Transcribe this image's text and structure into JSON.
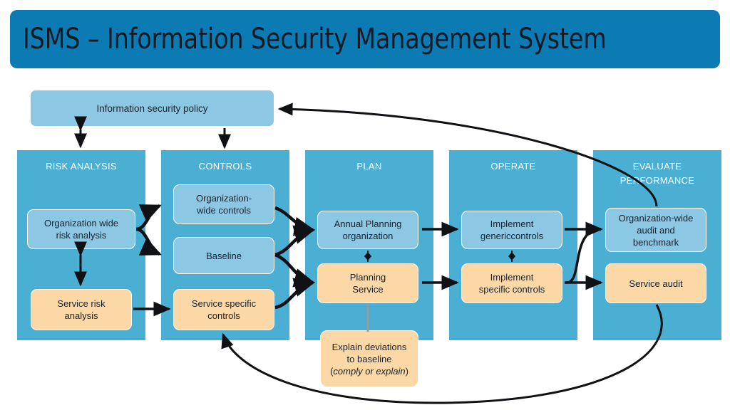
{
  "title": {
    "text": "ISMS – Information Security Management System"
  },
  "policy": {
    "label": "Information security policy"
  },
  "colors": {
    "title_bar": "#0C7BB3",
    "panel": "#4BAFD4",
    "node_blue": "#8CC8E4",
    "node_orange": "#FBD8A5",
    "connector": "#0f1115",
    "text": "#17212E"
  },
  "columns": [
    {
      "key": "risk_analysis",
      "title": "RISK ANALYSIS",
      "nodes": [
        {
          "key": "org_risk",
          "label": "Organization wide risk analysis",
          "color": "blue"
        },
        {
          "key": "service_risk",
          "label": "Service risk analysis",
          "color": "orange"
        }
      ]
    },
    {
      "key": "controls",
      "title": "CONTROLS",
      "nodes": [
        {
          "key": "org_controls",
          "label": "Organization-wide controls",
          "color": "blue"
        },
        {
          "key": "baseline",
          "label": "Baseline",
          "color": "blue"
        },
        {
          "key": "service_specific_controls",
          "label": "Service specific controls",
          "color": "orange"
        }
      ]
    },
    {
      "key": "plan",
      "title": "PLAN",
      "nodes": [
        {
          "key": "annual_planning",
          "label": "Annual Planning organization",
          "color": "blue"
        },
        {
          "key": "planning_service",
          "label": "Planning Service",
          "color": "orange"
        },
        {
          "key": "explain_deviations",
          "label": "Explain deviations to baseline (comply or explain)",
          "color": "orange"
        }
      ]
    },
    {
      "key": "operate",
      "title": "OPERATE",
      "nodes": [
        {
          "key": "implement_generic",
          "label": "Implement genericcontrols",
          "color": "blue"
        },
        {
          "key": "implement_specific",
          "label": "Implement specific controls",
          "color": "orange"
        }
      ]
    },
    {
      "key": "evaluate",
      "title_line1": "EVALUATE",
      "title_line2": "PERFORMANCE",
      "title": "EVALUATE PERFORMANCE",
      "nodes": [
        {
          "key": "org_audit",
          "label": "Organization-wide audit and benchmark",
          "color": "blue"
        },
        {
          "key": "service_audit",
          "label": "Service audit",
          "color": "orange"
        }
      ]
    }
  ],
  "node_labels": {
    "org_risk_line1": "Organization wide",
    "org_risk_line2": "risk analysis",
    "service_risk_line1": "Service risk",
    "service_risk_line2": "analysis",
    "org_controls_line1": "Organization-",
    "org_controls_line2": "wide controls",
    "baseline": "Baseline",
    "svc_controls_line1": "Service specific",
    "svc_controls_line2": "controls",
    "annual_plan_line1": "Annual Planning",
    "annual_plan_line2": "organization",
    "plan_service_line1": "Planning",
    "plan_service_line2": "Service",
    "explain_line1": "Explain deviations",
    "explain_line2": "to baseline",
    "explain_line3_open": "(",
    "explain_line3_italic": "comply or explain",
    "explain_line3_close": ")",
    "impl_generic_line1": "Implement",
    "impl_generic_line2": "genericcontrols",
    "impl_specific_line1": "Implement",
    "impl_specific_line2": "specific controls",
    "org_audit_line1": "Organization-wide",
    "org_audit_line2": "audit and",
    "org_audit_line3": "benchmark",
    "service_audit": "Service audit"
  }
}
